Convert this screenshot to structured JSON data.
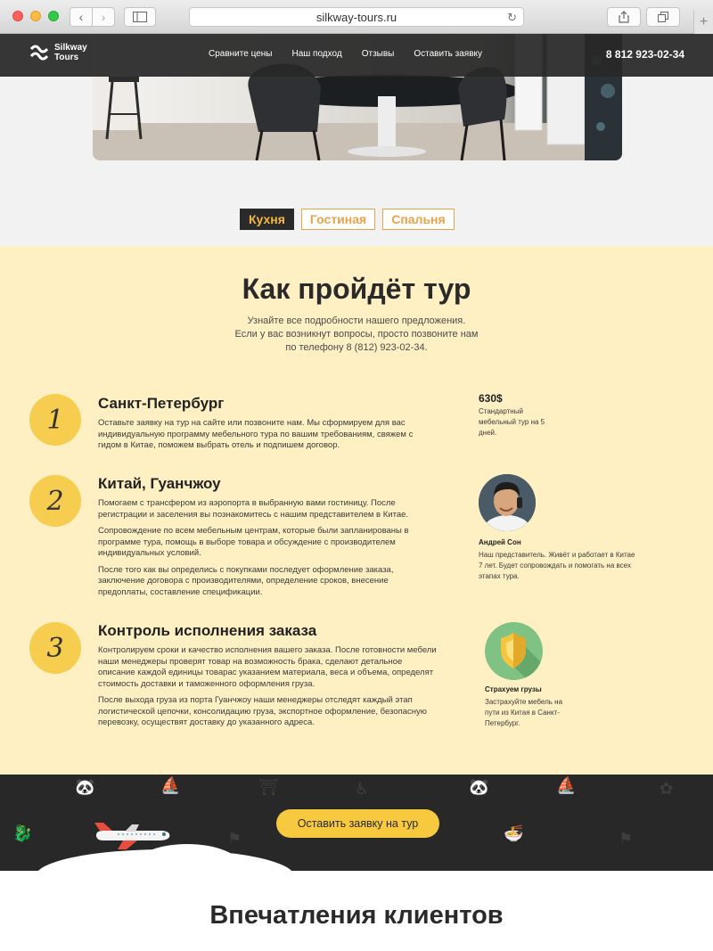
{
  "browser": {
    "url": "silkway-tours.ru"
  },
  "nav": {
    "logo_line1": "Silkway",
    "logo_line2": "Tours",
    "links": [
      "Сравните цены",
      "Наш подход",
      "Отзывы",
      "Оставить заявку"
    ],
    "phone": "8 812 923-02-34"
  },
  "gallery": {
    "tabs": [
      "Кухня",
      "Гостиная",
      "Спальня"
    ],
    "active_tab": "Кухня"
  },
  "tour": {
    "title": "Как пройдёт тур",
    "subtitle_lines": [
      "Узнайте все подробности нашего предложения.",
      "Если у вас возникнут вопросы, просто позвоните нам",
      "по телефону 8 (812) 923-02-34."
    ],
    "steps": [
      {
        "number": "1",
        "title": "Санкт-Петербург",
        "paragraphs": [
          "Оставьте заявку на тур на сайте или позвоните нам. Мы сформируем для вас индивидуальную программу мебельного тура по вашим требованиям, свяжем с гидом в Китае, поможем выбрать отель и подпишем договор."
        ]
      },
      {
        "number": "2",
        "title": "Китай, Гуанчжоу",
        "paragraphs": [
          "Помогаем с трансфером из аэропорта в выбранную вами гостиницу. После регистрации и заселения вы познакомитесь с нашим представителем в Китае.",
          "Сопровождение по всем мебельным центрам, которые были запланированы в программе тура, помощь в выборе товара и обсуждение с производителем индивидуальных условий.",
          "После того как вы определись с покупками последует оформление заказа, заключение договора с производителями, определение сроков, внесение предоплаты, составление спецификации."
        ]
      },
      {
        "number": "3",
        "title": "Контроль исполнения заказа",
        "paragraphs": [
          "Контролируем сроки и качество исполнения вашего заказа. После готовности мебели наши менеджеры проверят товар на возможность брака, сделают детальное описание каждой единицы товарас указанием материала, веса и объема, определят стоимость доставки и таможенного оформления груза.",
          "После выхода груза из порта Гуанчжоу наши менеджеры отследят каждый этап логистической цепочки, консолидацию груза, экспортное оформление, безопасную перевозку, осуществят доставку до указанного адреса."
        ]
      }
    ],
    "side1": {
      "price": "630$",
      "text": "Стандартный мебельный тур на 5 дней."
    },
    "side2": {
      "name": "Андрей Сон",
      "text": "Наш представитель. Живёт и работает в Китае 7 лет. Будет сопровождать и помогать на всех этапах тура."
    },
    "side3": {
      "name": "Страхуем грузы",
      "text": "Застрахуйте мебель на пути из Китая в Санкт-Петербург."
    }
  },
  "cta": {
    "button_label": "Оставить заявку на тур"
  },
  "reviews": {
    "title": "Впечатления клиентов"
  },
  "colors": {
    "accent_yellow": "#f7cd4f",
    "tour_bg": "#fff0c4",
    "dark": "#282828",
    "tab_orange": "#e8a34a"
  }
}
